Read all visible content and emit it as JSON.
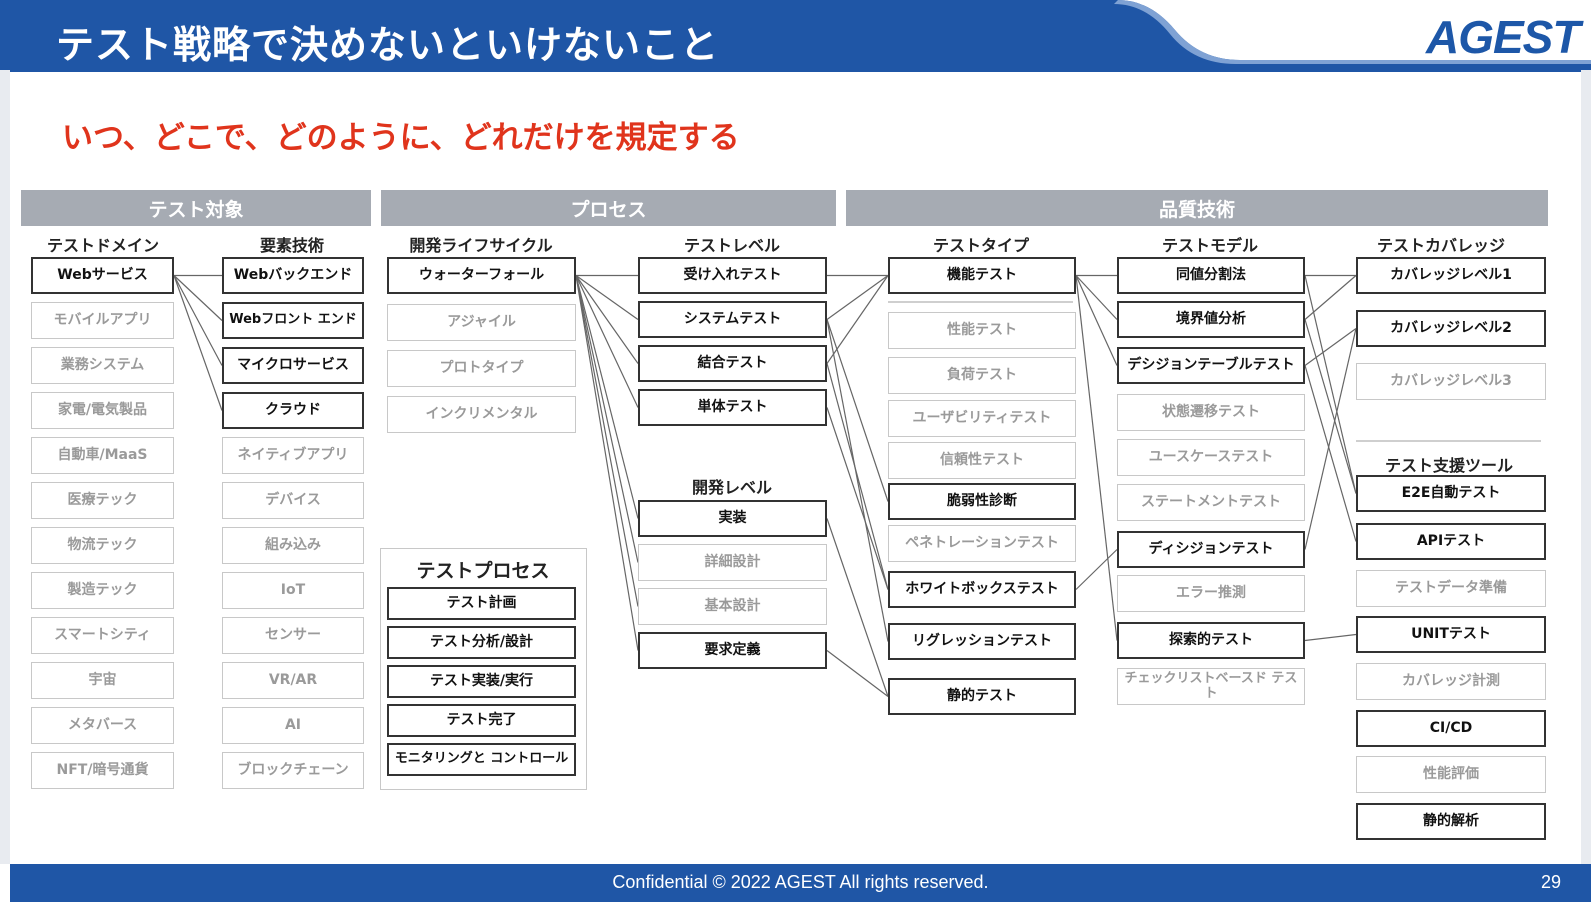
{
  "header": {
    "title": "テスト戦略で決めないといけないこと",
    "brand": "AGEST"
  },
  "subtitle": "いつ、どこで、どのように、どれだけを規定する",
  "sections": [
    "テスト対象",
    "プロセス",
    "品質技術"
  ],
  "columns": {
    "domain": {
      "title": "テストドメイン",
      "items": [
        {
          "label": "Webサービス",
          "active": true
        },
        {
          "label": "モバイルアプリ",
          "active": false
        },
        {
          "label": "業務システム",
          "active": false
        },
        {
          "label": "家電/電気製品",
          "active": false
        },
        {
          "label": "自動車/MaaS",
          "active": false
        },
        {
          "label": "医療テック",
          "active": false
        },
        {
          "label": "物流テック",
          "active": false
        },
        {
          "label": "製造テック",
          "active": false
        },
        {
          "label": "スマートシティ",
          "active": false
        },
        {
          "label": "宇宙",
          "active": false
        },
        {
          "label": "メタバース",
          "active": false
        },
        {
          "label": "NFT/暗号通貨",
          "active": false
        }
      ]
    },
    "tech": {
      "title": "要素技術",
      "items": [
        {
          "label": "Webバックエンド",
          "active": true
        },
        {
          "label": "Webフロント エンド",
          "active": true
        },
        {
          "label": "マイクロサービス",
          "active": true
        },
        {
          "label": "クラウド",
          "active": true
        },
        {
          "label": "ネイティブアプリ",
          "active": false
        },
        {
          "label": "デバイス",
          "active": false
        },
        {
          "label": "組み込み",
          "active": false
        },
        {
          "label": "IoT",
          "active": false
        },
        {
          "label": "センサー",
          "active": false
        },
        {
          "label": "VR/AR",
          "active": false
        },
        {
          "label": "AI",
          "active": false
        },
        {
          "label": "ブロックチェーン",
          "active": false
        }
      ]
    },
    "lifecycle": {
      "title": "開発ライフサイクル",
      "items": [
        {
          "label": "ウォーターフォール",
          "active": true
        },
        {
          "label": "アジャイル",
          "active": false
        },
        {
          "label": "プロトタイプ",
          "active": false
        },
        {
          "label": "インクリメンタル",
          "active": false
        }
      ]
    },
    "levels": {
      "title": "テストレベル",
      "items": [
        {
          "label": "受け入れテスト",
          "active": true
        },
        {
          "label": "システムテスト",
          "active": true
        },
        {
          "label": "結合テスト",
          "active": true
        },
        {
          "label": "単体テスト",
          "active": true
        }
      ]
    },
    "dev_levels": {
      "title": "開発レベル",
      "items": [
        {
          "label": "実装",
          "active": true
        },
        {
          "label": "詳細設計",
          "active": false
        },
        {
          "label": "基本設計",
          "active": false
        },
        {
          "label": "要求定義",
          "active": true
        }
      ]
    },
    "test_process": {
      "title": "テストプロセス",
      "items": [
        {
          "label": "テスト計画",
          "active": true
        },
        {
          "label": "テスト分析/設計",
          "active": true
        },
        {
          "label": "テスト実装/実行",
          "active": true
        },
        {
          "label": "テスト完了",
          "active": true
        },
        {
          "label": "モニタリングと コントロール",
          "active": true
        }
      ]
    },
    "types": {
      "title": "テストタイプ",
      "items": [
        {
          "label": "機能テスト",
          "active": true
        },
        {
          "label": "性能テスト",
          "active": false
        },
        {
          "label": "負荷テスト",
          "active": false
        },
        {
          "label": "ユーザビリティテスト",
          "active": false
        },
        {
          "label": "信頼性テスト",
          "active": false
        },
        {
          "label": "脆弱性診断",
          "active": true
        },
        {
          "label": "ペネトレーションテスト",
          "active": false
        },
        {
          "label": "ホワイトボックステスト",
          "active": true
        },
        {
          "label": "リグレッションテスト",
          "active": true
        },
        {
          "label": "静的テスト",
          "active": true
        }
      ]
    },
    "models": {
      "title": "テストモデル",
      "items": [
        {
          "label": "同値分割法",
          "active": true
        },
        {
          "label": "境界値分析",
          "active": true
        },
        {
          "label": "デシジョンテーブルテスト",
          "active": true
        },
        {
          "label": "状態遷移テスト",
          "active": false
        },
        {
          "label": "ユースケーステスト",
          "active": false
        },
        {
          "label": "ステートメントテスト",
          "active": false
        },
        {
          "label": "ディシジョンテスト",
          "active": true
        },
        {
          "label": "エラー推測",
          "active": false
        },
        {
          "label": "探索的テスト",
          "active": true
        },
        {
          "label": "チェックリストベースド テスト",
          "active": false
        }
      ]
    },
    "coverage": {
      "title": "テストカバレッジ",
      "items": [
        {
          "label": "カバレッジレベル1",
          "active": true
        },
        {
          "label": "カバレッジレベル2",
          "active": true
        },
        {
          "label": "カバレッジレベル3",
          "active": false
        }
      ]
    },
    "tools": {
      "title": "テスト支援ツール",
      "items": [
        {
          "label": "E2E自動テスト",
          "active": true
        },
        {
          "label": "APIテスト",
          "active": true
        },
        {
          "label": "テストデータ準備",
          "active": false
        },
        {
          "label": "UNITテスト",
          "active": true
        },
        {
          "label": "カバレッジ計測",
          "active": false
        },
        {
          "label": "CI/CD",
          "active": true
        },
        {
          "label": "性能評価",
          "active": false
        },
        {
          "label": "静的解析",
          "active": true
        }
      ]
    }
  },
  "footer": {
    "copyright": "Confidential © 2022 AGEST All rights reserved.",
    "page": "29"
  },
  "colors": {
    "brand_blue": "#1f56a6",
    "accent_red": "#e0341c",
    "section_gray": "#a6abb3"
  }
}
